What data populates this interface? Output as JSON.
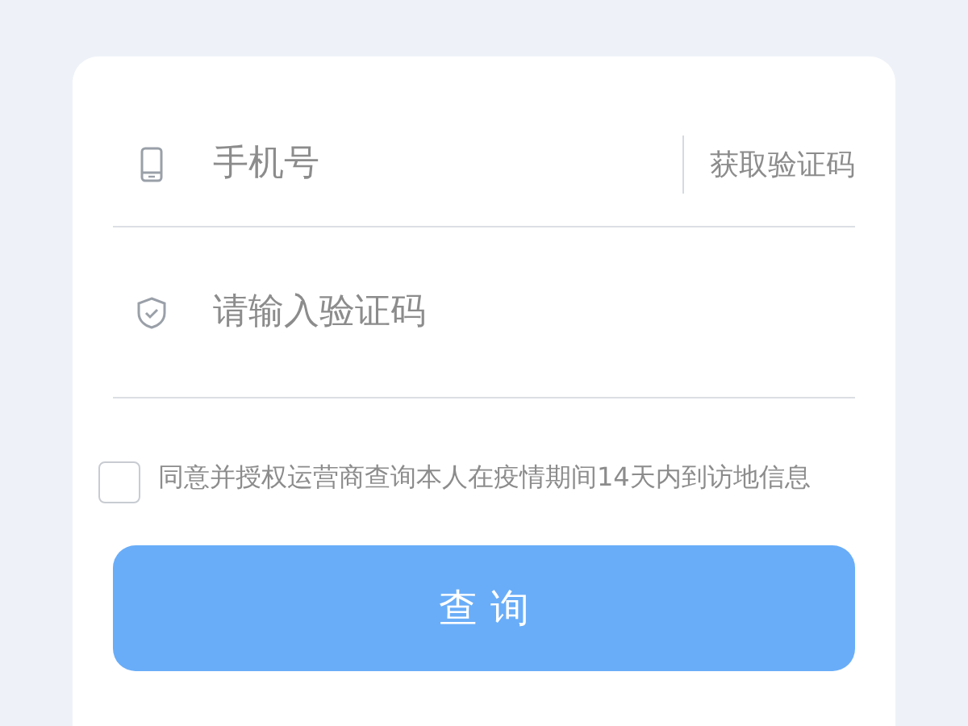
{
  "phone_field": {
    "placeholder": "手机号"
  },
  "get_code_button": {
    "label": "获取验证码"
  },
  "code_field": {
    "placeholder": "请输入验证码"
  },
  "agreement": {
    "checked": false,
    "text": "同意并授权运营商查询本人在疫情期间14天内到访地信息"
  },
  "query_button": {
    "label": "查 询"
  }
}
